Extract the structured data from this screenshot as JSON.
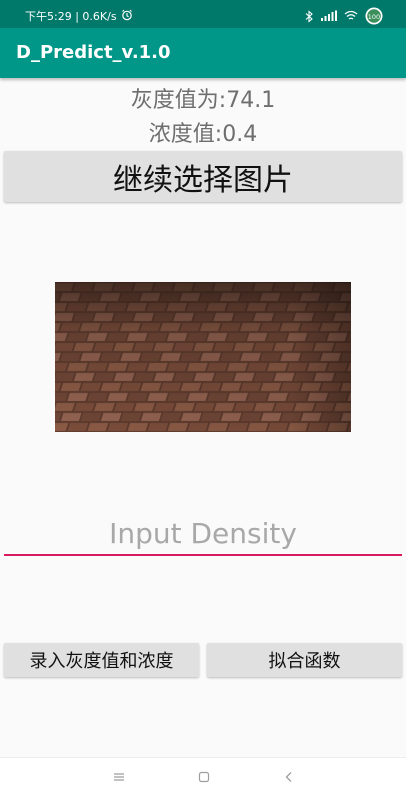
{
  "status_bar": {
    "time_speed": "下午5:29 | 0.6K/s",
    "battery_level": "100"
  },
  "app_bar": {
    "title": "D_Predict_v.1.0"
  },
  "gray_value_text": "灰度值为:74.1",
  "density_text": "浓度值:0.4",
  "choose_image_button": "继续选择图片",
  "density_input": {
    "placeholder": "Input Density",
    "value": ""
  },
  "record_button": "录入灰度值和浓度",
  "fit_button": "拟合函数",
  "colors": {
    "status_bar": "#00796b",
    "app_bar": "#009688",
    "input_underline": "#d81b60"
  }
}
